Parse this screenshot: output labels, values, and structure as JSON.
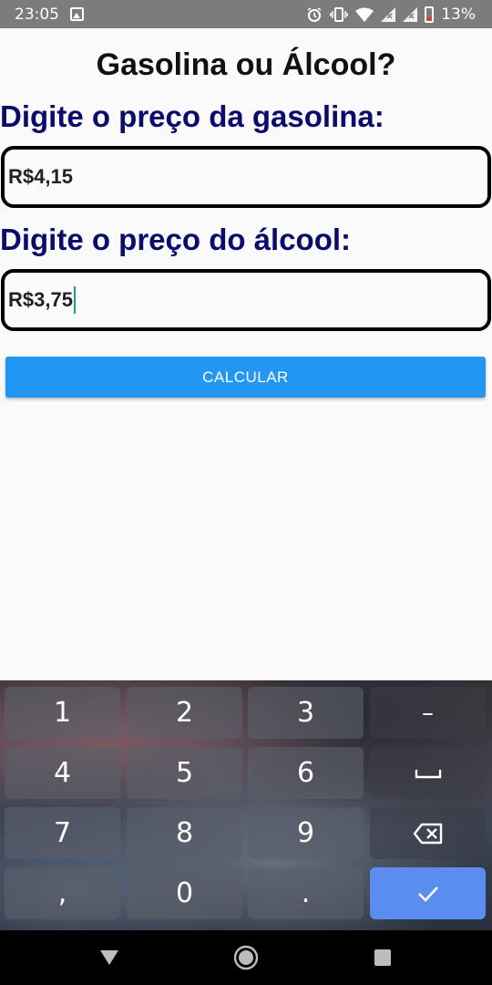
{
  "status_bar": {
    "time": "23:05",
    "battery": "13%",
    "icons": [
      "image-icon",
      "alarm-icon",
      "vibrate-icon",
      "wifi-icon",
      "signal-icon",
      "signal-icon",
      "battery-low-icon"
    ]
  },
  "app": {
    "title": "Gasolina ou Álcool?",
    "gas_label": "Digite o preço da gasolina:",
    "gas_value": "R$4,15",
    "alcohol_label": "Digite o preço do álcool:",
    "alcohol_value": "R$3,75",
    "calc_label": "CALCULAR"
  },
  "colors": {
    "label_color": "#0b0b6e",
    "button_color": "#2196f3",
    "done_key_color": "#5b8def"
  },
  "keyboard": {
    "keys": {
      "k1": "1",
      "k2": "2",
      "k3": "3",
      "minus": "–",
      "k4": "4",
      "k5": "5",
      "k6": "6",
      "k7": "7",
      "k8": "8",
      "k9": "9",
      "comma": ",",
      "k0": "0",
      "period": "."
    },
    "icons": [
      "space-icon",
      "backspace-icon",
      "check-icon"
    ]
  },
  "nav": {
    "icons": [
      "back-icon",
      "home-icon",
      "recents-icon"
    ]
  }
}
